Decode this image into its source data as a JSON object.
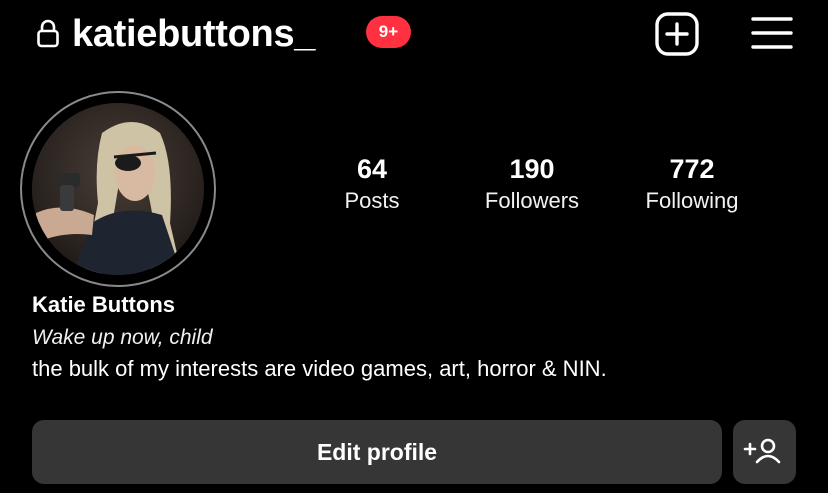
{
  "header": {
    "lock_icon": "lock-icon",
    "username": "katiebuttons_",
    "notification_badge": "9+",
    "badge_color": "#ff3040",
    "create_icon": "plus-square-icon",
    "menu_icon": "hamburger-menu-icon"
  },
  "profile": {
    "stats": [
      {
        "value": "64",
        "label": "Posts"
      },
      {
        "value": "190",
        "label": "Followers"
      },
      {
        "value": "772",
        "label": "Following"
      }
    ],
    "display_name": "Katie Buttons",
    "pronoun_line": "Wake up now, child",
    "bio": "the bulk of my interests are video games, art, horror & NIN."
  },
  "actions": {
    "edit_profile_label": "Edit profile",
    "suggest_icon": "add-person-icon",
    "button_color": "#363636"
  }
}
